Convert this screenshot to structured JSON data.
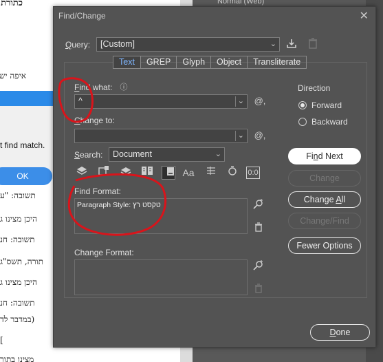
{
  "background": {
    "doc_lines": [
      "כתורת משנתה",
      "איפה יש פס",
      "תשובה: \"ע",
      "היכן מצינו ג",
      "תשובה: חנ",
      "תורה, תשס\"ג",
      "היכן מצינו ג",
      "תשובה: חנ",
      "(במדבר לד",
      "]",
      "מצינו בתור"
    ],
    "alert": {
      "message": "t find match.",
      "ok_label": "OK"
    },
    "panel_label": "Normal (Web)"
  },
  "dialog": {
    "title": "Find/Change",
    "close_glyph": "✕",
    "query_label": "Query:",
    "query_value": "[Custom]",
    "tabs": [
      "Text",
      "GREP",
      "Glyph",
      "Object",
      "Transliterate"
    ],
    "active_tab": "Text",
    "find_what_label": "Find what:",
    "find_what_value": "^",
    "change_to_label": "Change to:",
    "change_to_value": "",
    "search_label": "Search:",
    "search_value": "Document",
    "find_format_label": "Find Format:",
    "find_format_value": "Paragraph Style: טקסט רץ",
    "change_format_label": "Change Format:",
    "change_format_value": "",
    "direction": {
      "label": "Direction",
      "forward": "Forward",
      "backward": "Backward",
      "selected": "Forward"
    },
    "buttons": {
      "find_next": "Find Next",
      "change": "Change",
      "change_all": "Change All",
      "change_find": "Change/Find",
      "fewer_options": "Fewer Options",
      "done": "Done"
    },
    "search_option_icons": [
      "Aa",
      "0:0"
    ]
  },
  "colors": {
    "dialog_bg": "#535353",
    "active_tab_text": "#7fb6ff",
    "annotation": "#d9141b"
  }
}
